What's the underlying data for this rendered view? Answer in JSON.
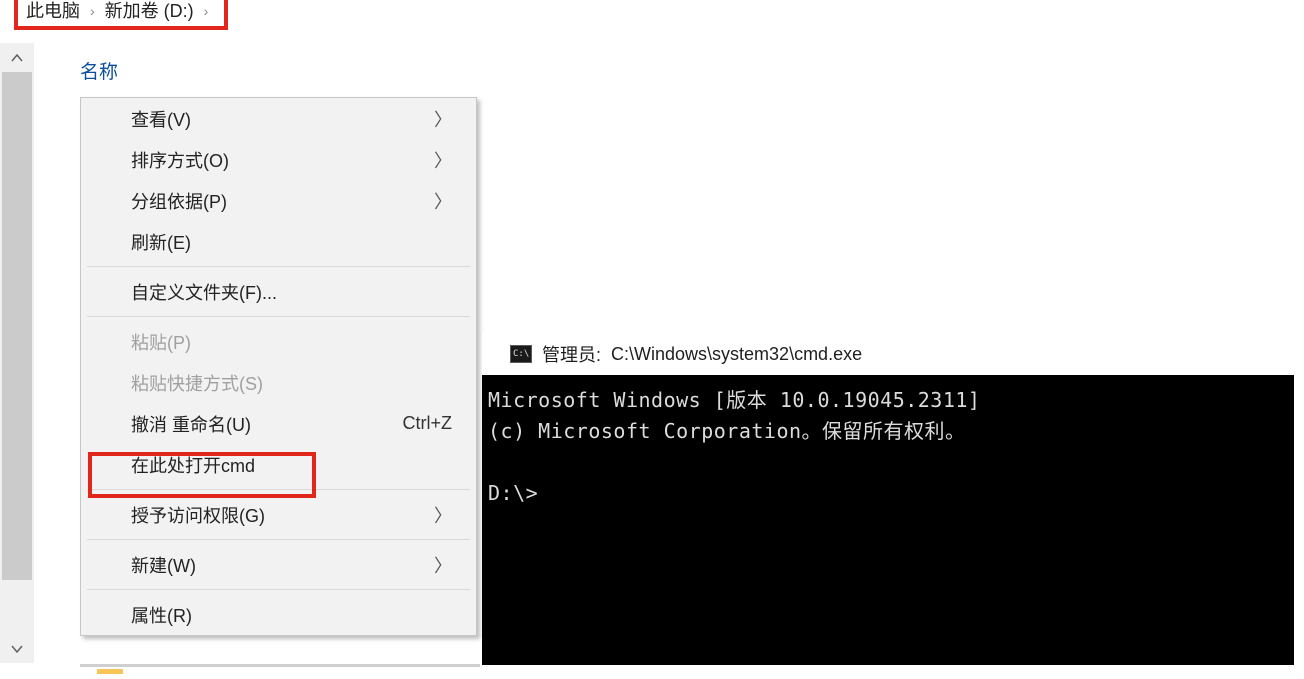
{
  "breadcrumb": {
    "items": [
      "此电脑",
      "新加卷 (D:)"
    ],
    "separator": "›"
  },
  "explorer": {
    "columns": {
      "name": "名称"
    }
  },
  "context_menu": {
    "view": {
      "label": "查看(V)"
    },
    "sort": {
      "label": "排序方式(O)"
    },
    "group": {
      "label": "分组依据(P)"
    },
    "refresh": {
      "label": "刷新(E)"
    },
    "customize": {
      "label": "自定义文件夹(F)..."
    },
    "paste": {
      "label": "粘贴(P)"
    },
    "paste_shortcut": {
      "label": "粘贴快捷方式(S)"
    },
    "undo_rename": {
      "label": "撤消 重命名(U)",
      "shortcut": "Ctrl+Z"
    },
    "open_cmd_here": {
      "label": "在此处打开cmd"
    },
    "give_access": {
      "label": "授予访问权限(G)"
    },
    "new": {
      "label": "新建(W)"
    },
    "properties": {
      "label": "属性(R)"
    }
  },
  "cmd": {
    "title_prefix": "管理员:",
    "title_path": "C:\\Windows\\system32\\cmd.exe",
    "line1": "Microsoft Windows [版本 10.0.19045.2311]",
    "line2": "(c) Microsoft Corporation。保留所有权利。",
    "prompt": "D:\\>"
  }
}
